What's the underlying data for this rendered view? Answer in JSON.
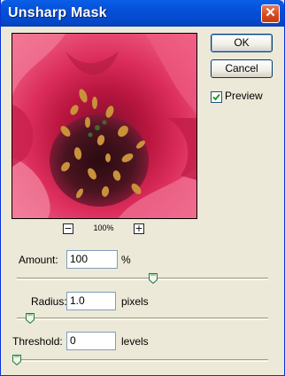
{
  "window": {
    "title": "Unsharp Mask",
    "close_glyph": "✕"
  },
  "preview": {
    "zoom": "100%",
    "zoom_out_glyph": "−",
    "zoom_in_glyph": "+"
  },
  "buttons": {
    "ok": "OK",
    "cancel": "Cancel"
  },
  "preview_toggle": {
    "label": "Preview",
    "checked": true
  },
  "amount": {
    "label": "Amount:",
    "value": "100",
    "unit": "%",
    "slider_fraction": 0.55
  },
  "radius": {
    "label": "Radius:",
    "value": "1.0",
    "unit": "pixels",
    "slider_fraction": 0.05
  },
  "threshold": {
    "label": "Threshold:",
    "value": "0",
    "unit": "levels",
    "slider_fraction": 0.0
  },
  "colors": {
    "titlebar": "#0550d8",
    "dialog_bg": "#ece9d8",
    "flower_pink": "#e0356a"
  }
}
